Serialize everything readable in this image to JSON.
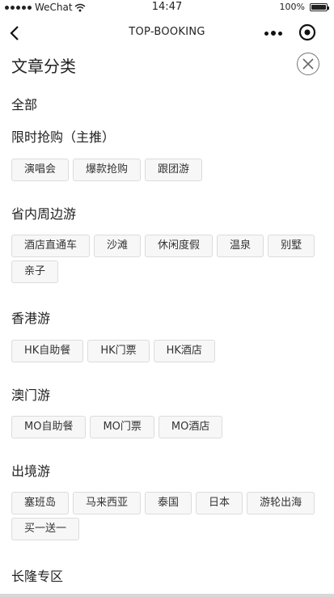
{
  "status_bar": {
    "carrier": "WeChat",
    "time": "14:47",
    "battery": "100%",
    "battery_level": 1.0
  },
  "nav": {
    "title": "TOP-BOOKING"
  },
  "page": {
    "title": "文章分类",
    "all_label": "全部"
  },
  "sections": [
    {
      "title": "限时抢购（主推）",
      "tags": [
        "演唱会",
        "爆款抢购",
        "跟团游"
      ]
    },
    {
      "title": "省内周边游",
      "tags": [
        "酒店直通车",
        "沙滩",
        "休闲度假",
        "温泉",
        "别墅",
        "亲子"
      ]
    },
    {
      "title": "香港游",
      "tags": [
        "HK自助餐",
        "HK门票",
        "HK酒店"
      ]
    },
    {
      "title": "澳门游",
      "tags": [
        "MO自助餐",
        "MO门票",
        "MO酒店"
      ]
    },
    {
      "title": "出境游",
      "tags": [
        "塞班岛",
        "马来西亚",
        "泰国",
        "日本",
        "游轮出海",
        "买一送一"
      ]
    },
    {
      "title": "长隆专区",
      "tags": []
    }
  ]
}
